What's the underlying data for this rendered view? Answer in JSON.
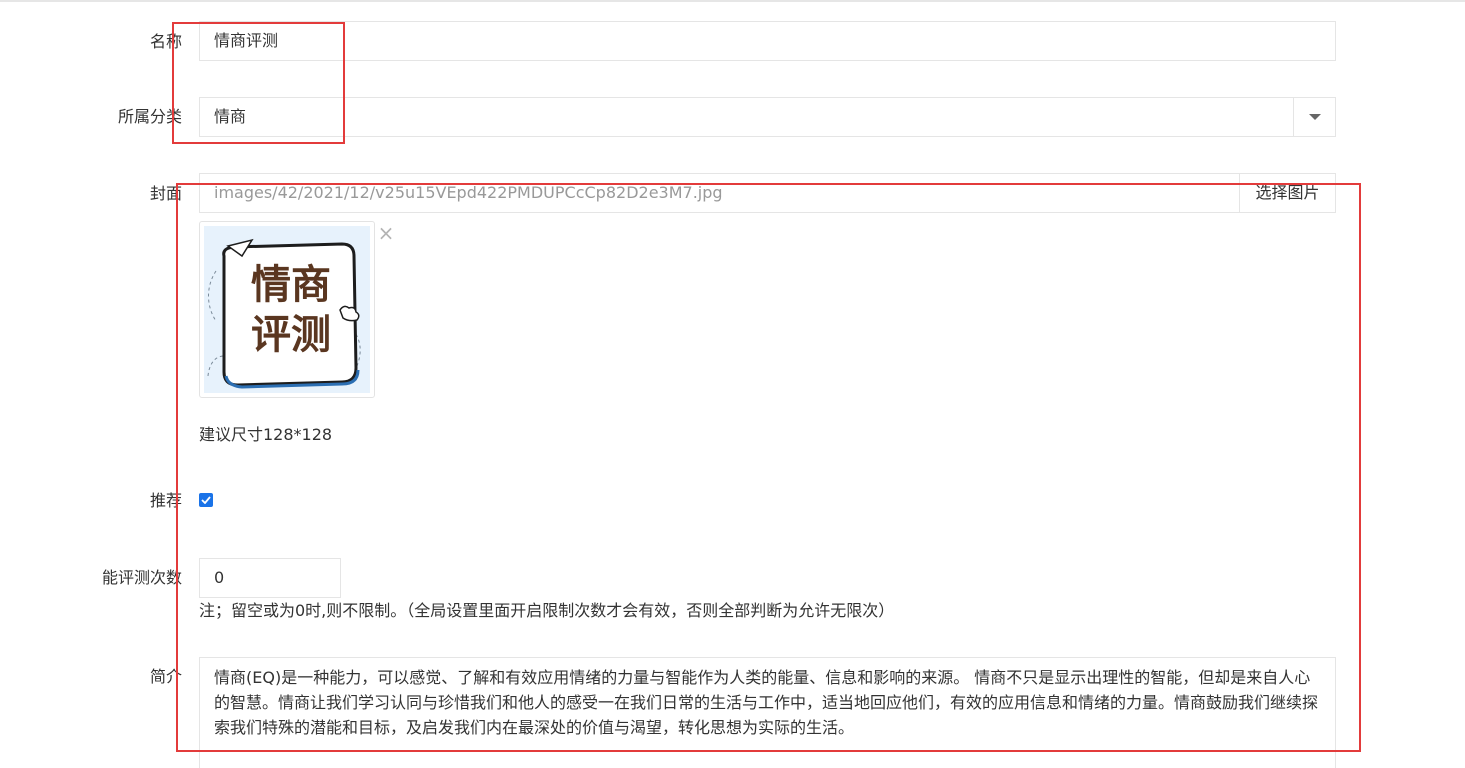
{
  "form": {
    "name_label": "名称",
    "name_value": "情商评测",
    "category_label": "所属分类",
    "category_value": "情商",
    "cover_label": "封面",
    "cover_path": "images/42/2021/12/v25u15VEpd422PMDUPCcCp82D2e3M7.jpg",
    "pick_image_button": "选择图片",
    "cover_image_text_line1": "情商",
    "cover_image_text_line2": "评测",
    "remove_icon": "×",
    "size_hint": "建议尺寸128*128",
    "recommend_label": "推荐",
    "recommend_checked": true,
    "attempts_label": "能评测次数",
    "attempts_value": "0",
    "attempts_note": "注；留空或为0时,则不限制。（全局设置里面开启限制次数才会有效，否则全部判断为允许无限次）",
    "intro_label": "简介",
    "intro_text": "情商(EQ)是一种能力，可以感觉、了解和有效应用情绪的力量与智能作为人类的能量、信息和影响的来源。 情商不只是显示出理性的智能，但却是来自人心的智慧。情商让我们学习认同与珍惜我们和他人的感受一在我们日常的生活与工作中，适当地回应他们，有效的应用信息和情绪的力量。情商鼓励我们继续探索我们特殊的潜能和目标，及启发我们内在最深处的价值与渴望，转化思想为实际的生活。"
  },
  "colors": {
    "annotation": "#e33b3b",
    "checkbox": "#1a73e8",
    "cover_bg": "#e7f2fc",
    "cover_text": "#5a3620"
  }
}
